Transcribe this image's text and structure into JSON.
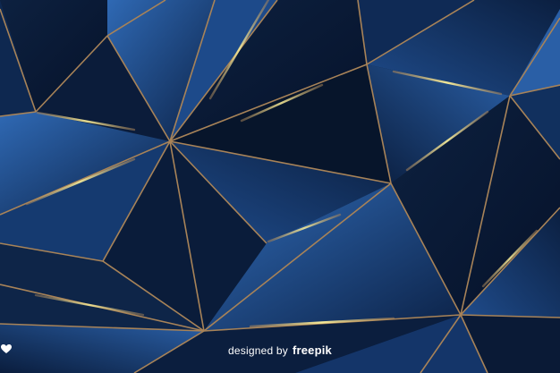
{
  "image": {
    "subject": "abstract-polygon-background",
    "colors": {
      "dark": "#07152b",
      "mid": "#163a6e",
      "bright": "#2f69b4",
      "edge": "#a88358",
      "glow": "#f2e070"
    }
  },
  "watermark": {
    "prefix": "designed by",
    "brand": "freepik",
    "icon": "freepik-logo-icon"
  }
}
